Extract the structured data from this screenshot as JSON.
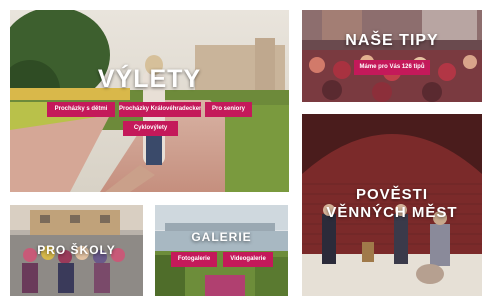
{
  "tiles": {
    "vylety": {
      "title": "VÝLETY",
      "buttons": [
        "Procházky s dětmi",
        "Procházky Královéhradeckem",
        "Pro seniory",
        "Cyklovýlety"
      ]
    },
    "nase_tipy": {
      "title": "NAŠE TIPY",
      "button": "Máme pro Vás 126 tipů"
    },
    "povesti": {
      "title_line1": "POVĚSTI",
      "title_line2": "VĚNNÝCH MĚST"
    },
    "pro_skoly": {
      "title": "PRO ŠKOLY"
    },
    "galerie": {
      "title": "GALERIE",
      "buttons": [
        "Fotogalerie",
        "Videogalerie"
      ]
    }
  },
  "colors": {
    "accent": "#c4195a",
    "text_on_image": "#ffffff"
  }
}
